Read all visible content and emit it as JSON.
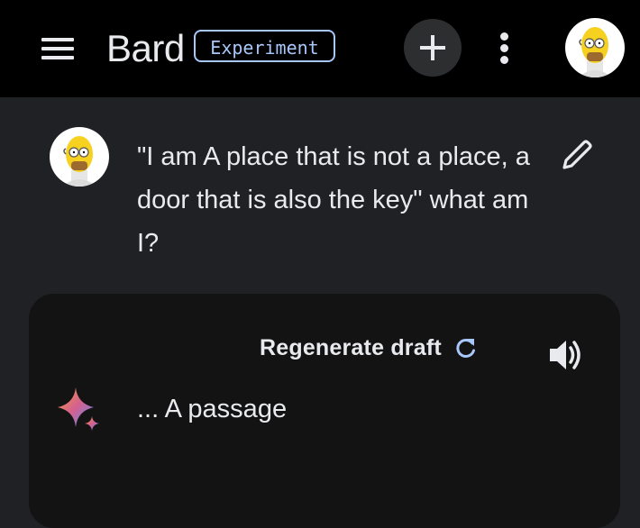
{
  "header": {
    "app_name": "Bard",
    "badge": "Experiment",
    "icons": {
      "menu": "menu-icon",
      "new_chat": "plus-icon",
      "more": "more-vert-icon",
      "account": "avatar"
    }
  },
  "conversation": {
    "user_query": "\"I am A place that is not a place, a door that is also the key\" what am I?",
    "response": {
      "regenerate_label": "Regenerate draft",
      "answer": "... A passage"
    }
  },
  "colors": {
    "background": "#202124",
    "topbar": "#000000",
    "card": "#131314",
    "badge": "#a8c7fa",
    "text": "#e8eaed"
  }
}
